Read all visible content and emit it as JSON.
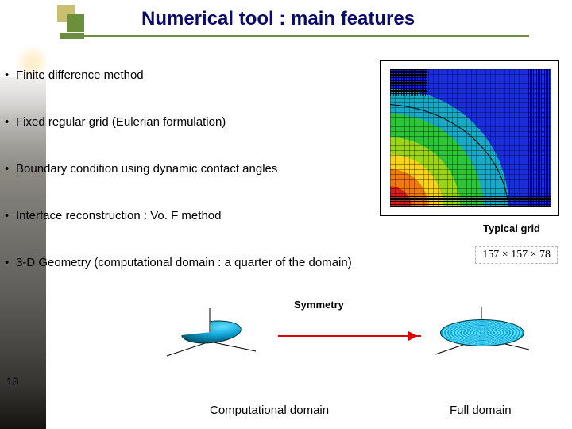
{
  "title": "Numerical tool : main features",
  "bullets": {
    "b1": "Finite difference method",
    "b2": "Fixed regular grid (Eulerian formulation)",
    "b3": "Boundary condition using dynamic contact angles",
    "b4": "Interface reconstruction : Vo. F method",
    "b5": "3-D Geometry (computational domain : a quarter of the domain)"
  },
  "grid": {
    "label": "Typical grid",
    "dimensions": "157 × 157 × 78"
  },
  "symmetry": {
    "label": "Symmetry",
    "caption_left": "Computational domain",
    "caption_right": "Full domain"
  },
  "slide_number": "18"
}
